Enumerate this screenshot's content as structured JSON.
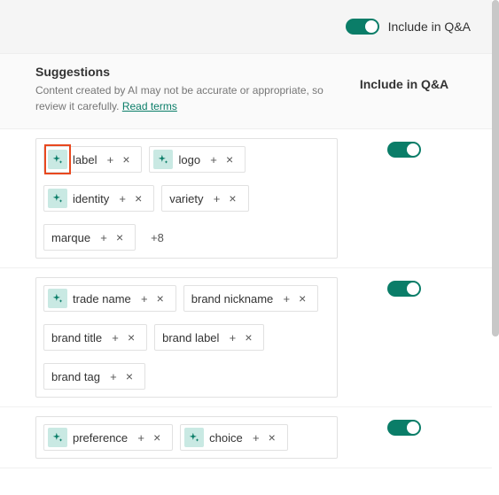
{
  "topBar": {
    "toggleLabel": "Include in Q&A"
  },
  "header": {
    "title": "Suggestions",
    "description": "Content created by AI may not be accurate or appropriate, so review it carefully.",
    "readTerms": "Read terms",
    "includeHeader": "Include in Q&A"
  },
  "glyphs": {
    "plus": "+",
    "close": "×"
  },
  "overflowMoreLabel": "+8",
  "groups": [
    {
      "id": "g1",
      "include": true,
      "overflowMore": true,
      "chips": [
        {
          "label": "label",
          "ai": true
        },
        {
          "label": "logo",
          "ai": true
        },
        {
          "label": "identity",
          "ai": true
        },
        {
          "label": "variety",
          "ai": false
        },
        {
          "label": "marque",
          "ai": false
        }
      ]
    },
    {
      "id": "g2",
      "include": true,
      "overflowMore": false,
      "chips": [
        {
          "label": "trade name",
          "ai": true
        },
        {
          "label": "brand nickname",
          "ai": false
        },
        {
          "label": "brand title",
          "ai": false
        },
        {
          "label": "brand label",
          "ai": false
        },
        {
          "label": "brand tag",
          "ai": false
        }
      ]
    },
    {
      "id": "g3",
      "include": true,
      "overflowMore": false,
      "chips": [
        {
          "label": "preference",
          "ai": true
        },
        {
          "label": "choice",
          "ai": true
        }
      ]
    }
  ]
}
